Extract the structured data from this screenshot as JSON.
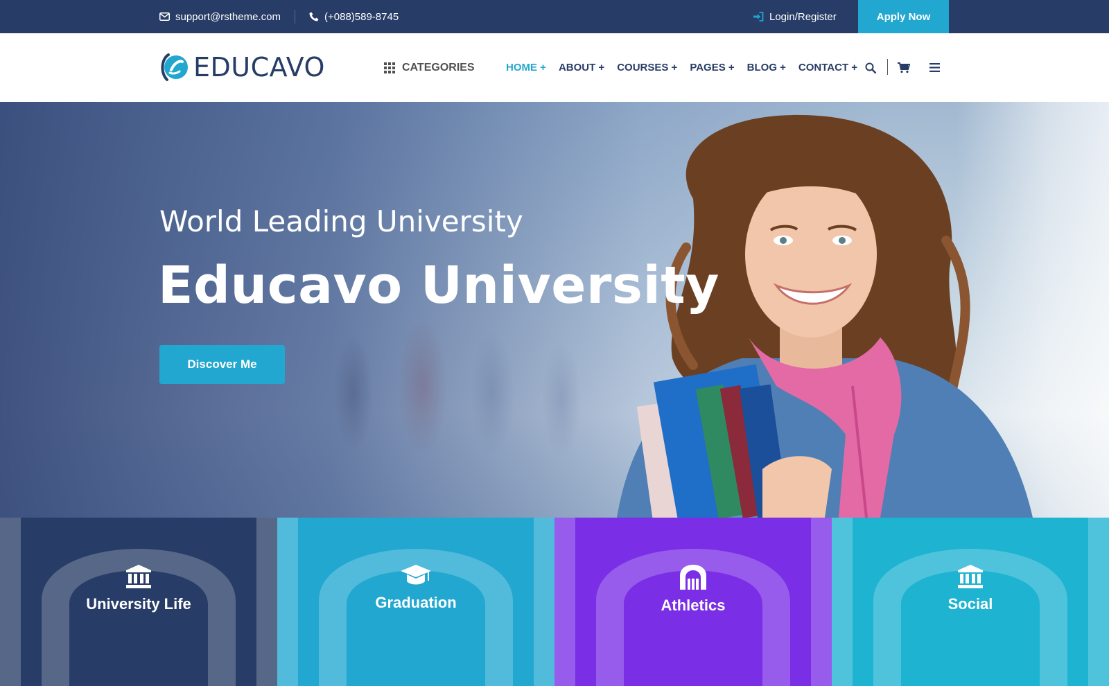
{
  "topbar": {
    "email": "support@rstheme.com",
    "phone": "(+088)589-8745",
    "login": "Login/Register",
    "apply": "Apply Now"
  },
  "header": {
    "logo_text": "EDUCAVO",
    "categories": "CATEGORIES",
    "nav": [
      {
        "label": "HOME +",
        "active": true
      },
      {
        "label": "ABOUT +"
      },
      {
        "label": "COURSES +"
      },
      {
        "label": "PAGES +"
      },
      {
        "label": "BLOG +"
      },
      {
        "label": "CONTACT +"
      }
    ]
  },
  "hero": {
    "subtitle": "World Leading University",
    "title": "Educavo University",
    "button": "Discover Me"
  },
  "tiles": [
    {
      "title": "University Life",
      "icon": "bank-icon",
      "color": "#273c66"
    },
    {
      "title": "Graduation",
      "icon": "graduation-cap-icon",
      "color": "#21a7d0"
    },
    {
      "title": "Athletics",
      "icon": "arch-building-icon",
      "color": "#7a2ee6"
    },
    {
      "title": "Social",
      "icon": "bank-icon",
      "color": "#1fb3d2"
    }
  ],
  "colors": {
    "primary": "#273c66",
    "accent": "#21a7d0",
    "purple": "#7a2ee6"
  }
}
